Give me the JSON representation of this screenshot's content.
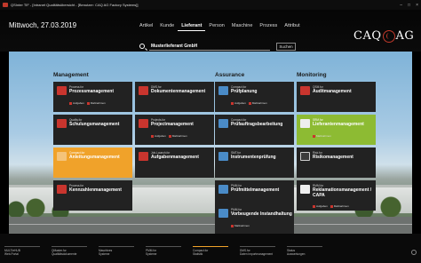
{
  "window": {
    "title": "QSInter TIF - [Intranet Qualitätsübersicht - [Benutzer: CAQ AG Factory Systems]]"
  },
  "header": {
    "date": "Mittwoch, 27.03.2019",
    "nav": [
      "Artikel",
      "Kunde",
      "Lieferant",
      "Person",
      "Maschine",
      "Prozess",
      "Attribut"
    ],
    "nav_active": "Lieferant",
    "search": {
      "value": "Musterlieferant GmbH",
      "button": "Suchen"
    },
    "logo": {
      "left": "CAQ",
      "right": "AG"
    }
  },
  "columns": {
    "management": "Management",
    "assurance": "Assurance",
    "monitoring": "Monitoring"
  },
  "tiles": {
    "proz": {
      "small": "Process.for",
      "big": "Prozessmanagement",
      "b1": "Aufgaben",
      "b2": "Maßnahmen"
    },
    "dok": {
      "small": "DMS.for",
      "big": "Dokumentenmanagement"
    },
    "pruef": {
      "small": "Compact.for",
      "big": "Prüfplanung",
      "b1": "Aufgaben",
      "b2": "Maßnahmen"
    },
    "audit": {
      "small": "QSM.for",
      "big": "Auditmanagement"
    },
    "schul": {
      "small": "Quality.for",
      "big": "Schulungsmanagement"
    },
    "proj": {
      "small": "Projects.for",
      "big": "Projectmanagement",
      "b1": "Aufgaben",
      "b2": "Maßnahmen"
    },
    "pruefb": {
      "small": "Compact.for",
      "big": "Prüfauftragsbearbeitung"
    },
    "liefer": {
      "small": "SRM.for",
      "big": "Lieferantenmanagement",
      "b1": "Maßnahmen"
    },
    "anl": {
      "small": "Compact.for",
      "big": "Anleitungsmanagement"
    },
    "aufg": {
      "small": "Job-Launch.for",
      "big": "Aufgabenmanagement"
    },
    "instr": {
      "small": "SMT.for",
      "big": "Instrumentenprüfung"
    },
    "risk": {
      "small": "Risk.for",
      "big": "Risikomanagement"
    },
    "kenn": {
      "small": "Process.for",
      "big": "Kennzahlenmanagement"
    },
    "pruefm": {
      "small": "PMM.for",
      "big": "Prüfmittelmanagement"
    },
    "rekl": {
      "small": "RMM.for",
      "big": "Reklamationsmanagement / CAPA",
      "b1": "Aufgaben",
      "b2": "Maßnahmen"
    },
    "inst": {
      "small": "PMM.for",
      "big": "Vorbeugende Instandhaltung",
      "b1": "Maßnahmen"
    }
  },
  "taskbar": [
    {
      "label": "MULTIeHUB\nWeb-Portal"
    },
    {
      "label": "QMaster.for\nQualitätsdokumente"
    },
    {
      "label": "Maschines\nSysteme"
    },
    {
      "label": "PMM.for\nSysteme"
    },
    {
      "label": "Compact.for\nStatistik"
    },
    {
      "label": "DMS.for\nDaten Importmanagement"
    },
    {
      "label": "Status\nAuswertungen"
    },
    {
      "label": ""
    }
  ],
  "colors": {
    "orange": "#f0a22a",
    "green": "#8dbb33",
    "red": "#c9352e",
    "blue": "#4a8bc7"
  }
}
